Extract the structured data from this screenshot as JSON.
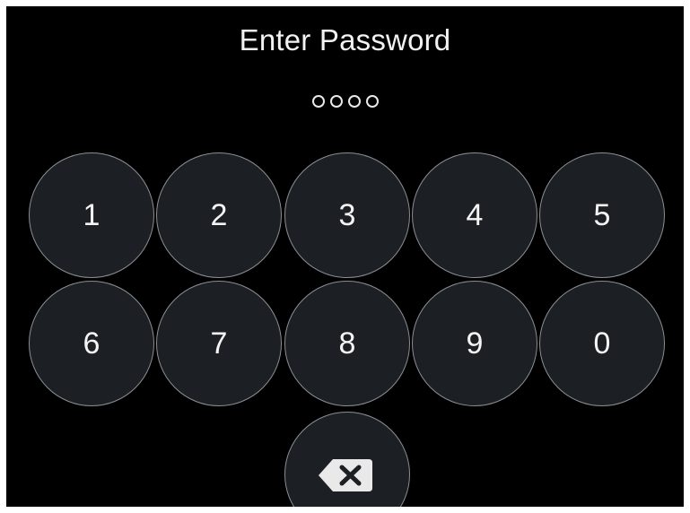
{
  "screen": {
    "title": "Enter Password",
    "entered_digit_count": 4
  },
  "keypad": {
    "keys": [
      {
        "label": "1"
      },
      {
        "label": "2"
      },
      {
        "label": "3"
      },
      {
        "label": "4"
      },
      {
        "label": "5"
      },
      {
        "label": "6"
      },
      {
        "label": "7"
      },
      {
        "label": "8"
      },
      {
        "label": "9"
      },
      {
        "label": "0"
      }
    ],
    "delete_icon": "backspace-icon"
  },
  "colors": {
    "background": "#000000",
    "key_fill": "#1c2024",
    "key_border": "#8a8f93",
    "text": "#f4f4f4"
  }
}
